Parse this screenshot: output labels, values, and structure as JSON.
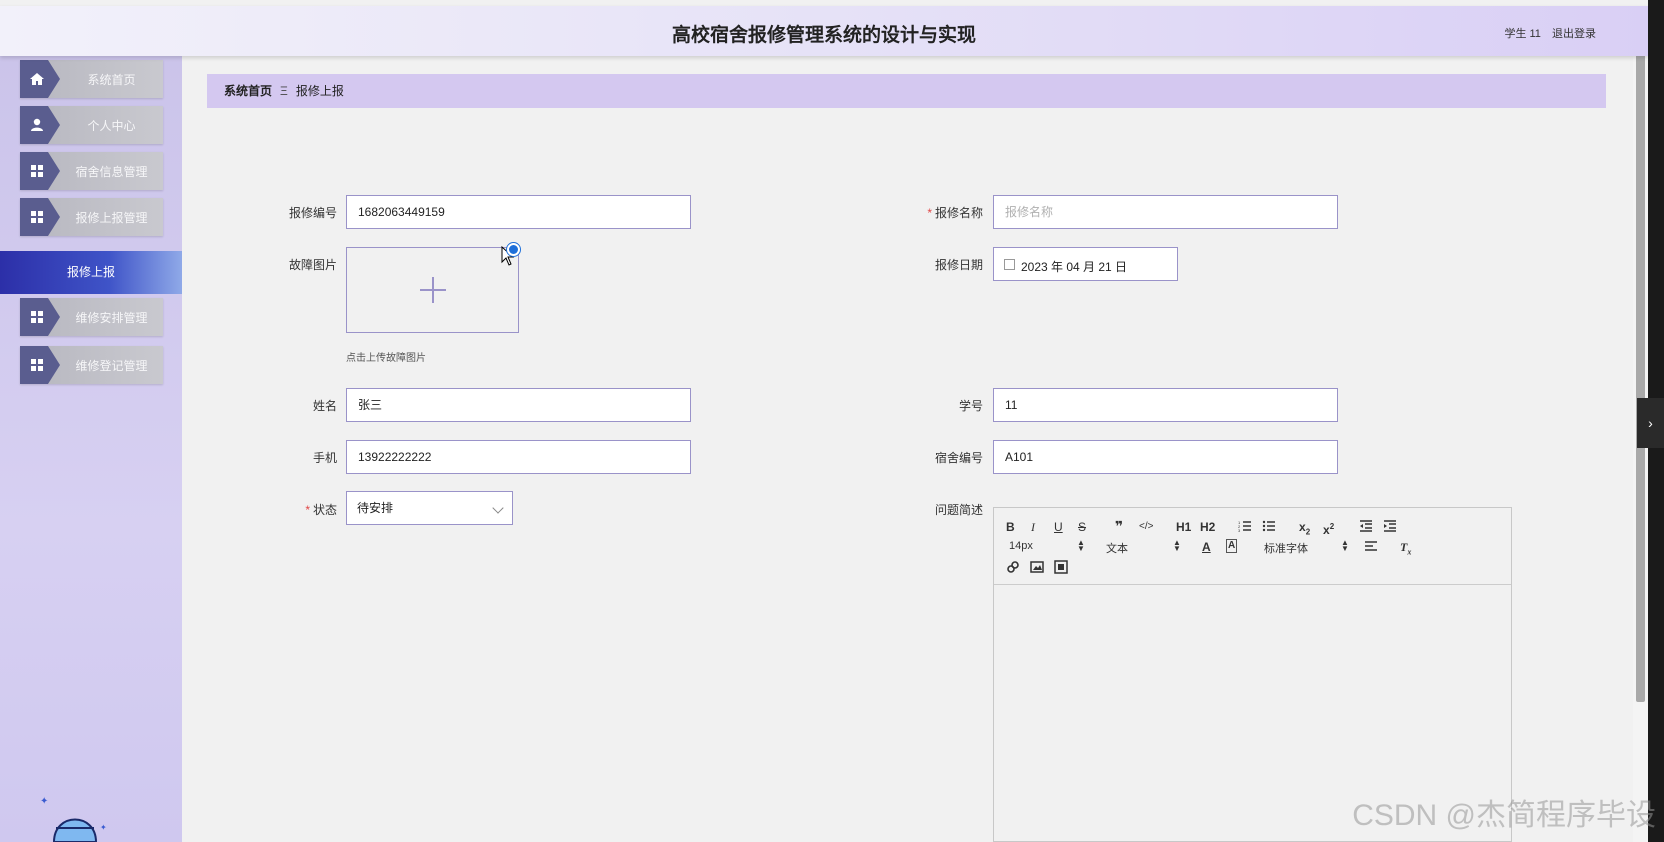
{
  "header": {
    "title": "高校宿舍报修管理系统的设计与实现",
    "user_label": "学生 11",
    "logout": "退出登录"
  },
  "sidebar": {
    "items": [
      {
        "label": "系统首页",
        "icon": "home-icon"
      },
      {
        "label": "个人中心",
        "icon": "user-icon"
      },
      {
        "label": "宿舍信息管理",
        "icon": "grid-icon"
      },
      {
        "label": "报修上报管理",
        "icon": "grid-icon"
      },
      {
        "label": "维修安排管理",
        "icon": "grid-icon"
      },
      {
        "label": "维修登记管理",
        "icon": "grid-icon"
      }
    ],
    "active_sub": "报修上报"
  },
  "breadcrumb": {
    "home": "系统首页",
    "separator": "Ξ",
    "current": "报修上报"
  },
  "form": {
    "repair_no": {
      "label": "报修编号",
      "value": "1682063449159"
    },
    "repair_name": {
      "label": "报修名称",
      "placeholder": "报修名称"
    },
    "fault_image": {
      "label": "故障图片",
      "hint": "点击上传故障图片"
    },
    "repair_date": {
      "label": "报修日期",
      "value": "2023 年 04 月 21 日"
    },
    "name": {
      "label": "姓名",
      "value": "张三"
    },
    "student_no": {
      "label": "学号",
      "value": "11"
    },
    "phone": {
      "label": "手机",
      "value": "13922222222"
    },
    "dorm_no": {
      "label": "宿舍编号",
      "value": "A101"
    },
    "status": {
      "label": "状态",
      "value": "待安排"
    },
    "description": {
      "label": "问题简述"
    }
  },
  "editor": {
    "font_size": "14px",
    "block_type": "文本",
    "font_family": "标准字体",
    "h1": "H1",
    "h2": "H2"
  },
  "watermark": "CSDN @杰简程序毕设",
  "colors": {
    "accent": "#9a93c9",
    "active_menu": "#2c2fa8",
    "breadcrumb_bg": "#d4c8f0",
    "required": "#e04545"
  }
}
